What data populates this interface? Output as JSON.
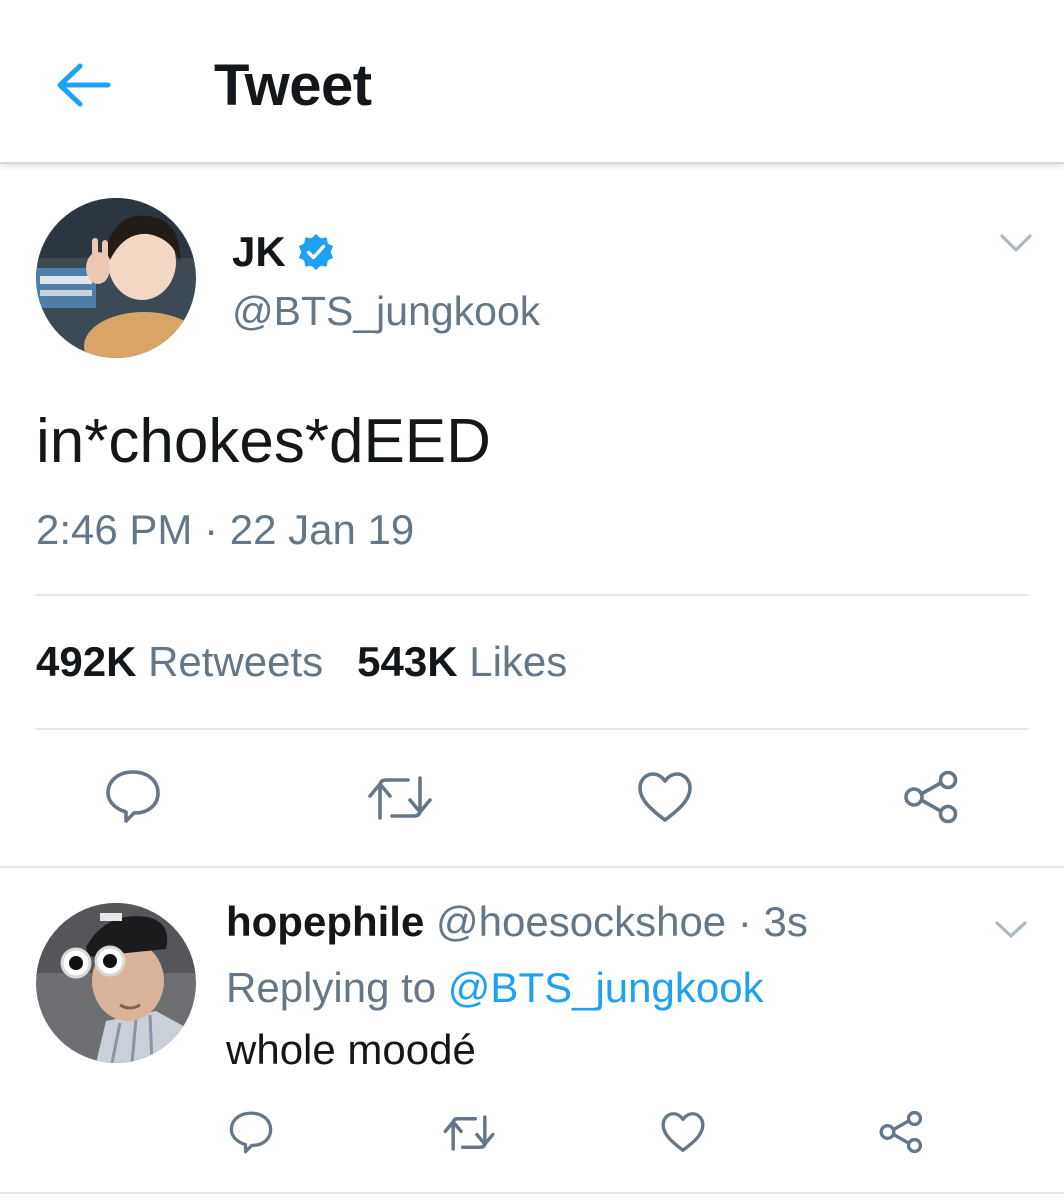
{
  "header": {
    "title": "Tweet"
  },
  "tweet": {
    "display_name": "JK",
    "handle": "@BTS_jungkook",
    "text": "in*chokes*dEED",
    "timestamp": "2:46 PM · 22 Jan 19",
    "retweets_count": "492K",
    "retweets_label": "Retweets",
    "likes_count": "543K",
    "likes_label": "Likes",
    "verified": true
  },
  "reply": {
    "display_name": "hopephile",
    "handle": "@hoesockshoe",
    "time": "· 3s",
    "replying_prefix": "Replying to",
    "replying_to": "@BTS_jungkook",
    "text": "whole moodé"
  },
  "colors": {
    "accent": "#1da1f2",
    "text": "#14171a",
    "secondary": "#657786",
    "divider": "#e1e8ed"
  },
  "icons": {
    "back": "arrow-left-icon",
    "verified": "verified-badge-icon",
    "caret": "chevron-down-icon",
    "reply": "reply-bubble-icon",
    "retweet": "retweet-icon",
    "like": "heart-icon",
    "share": "share-icon"
  }
}
